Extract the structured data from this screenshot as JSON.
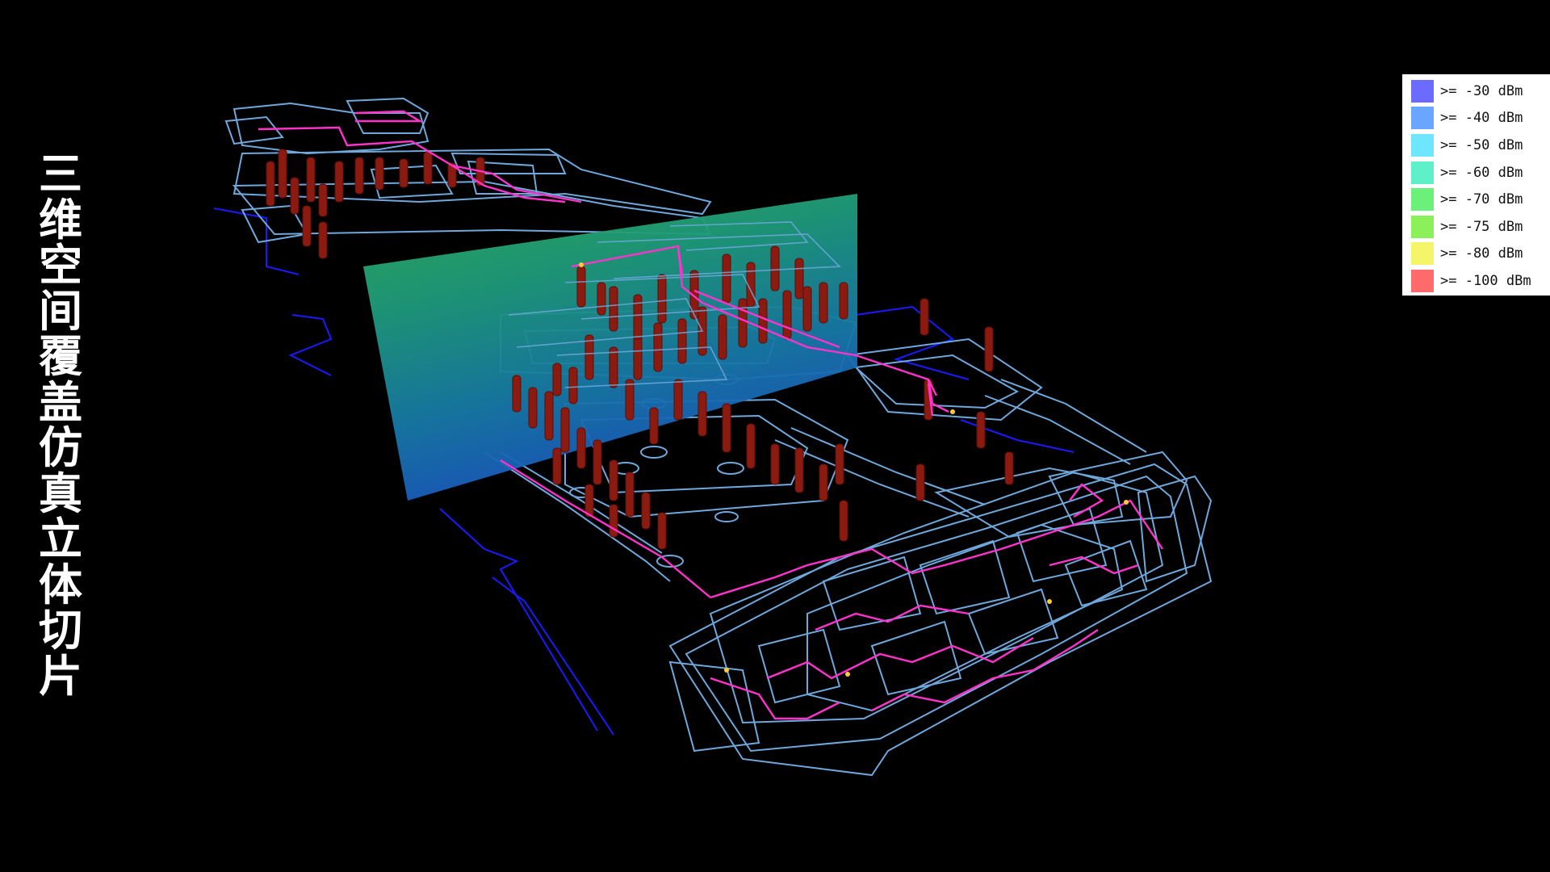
{
  "title": "三维空间覆盖仿真立体切片",
  "title_chars": [
    "三",
    "维",
    "空",
    "间",
    "覆",
    "盖",
    "仿",
    "真",
    "立",
    "体",
    "切",
    "片"
  ],
  "legend": {
    "items": [
      {
        "label": ">= -30 dBm",
        "color": "#6b6bff"
      },
      {
        "label": ">= -40 dBm",
        "color": "#6aa6ff"
      },
      {
        "label": ">= -50 dBm",
        "color": "#6ee6ff"
      },
      {
        "label": ">= -60 dBm",
        "color": "#5ef0c8"
      },
      {
        "label": ">= -70 dBm",
        "color": "#6bf07a"
      },
      {
        "label": ">= -75 dBm",
        "color": "#8cf05a"
      },
      {
        "label": ">= -80 dBm",
        "color": "#f5f56a"
      },
      {
        "label": ">= -100 dBm",
        "color": "#ff6b6b"
      }
    ]
  },
  "colors": {
    "background": "#000000",
    "wireframe": "#6fa8dc",
    "cable": "#ff33cc",
    "outline_dark": "#1a1aff",
    "pillar": "#8b1a10",
    "slice_top": "#2fbf6a",
    "slice_bottom": "#1a5fbf"
  }
}
